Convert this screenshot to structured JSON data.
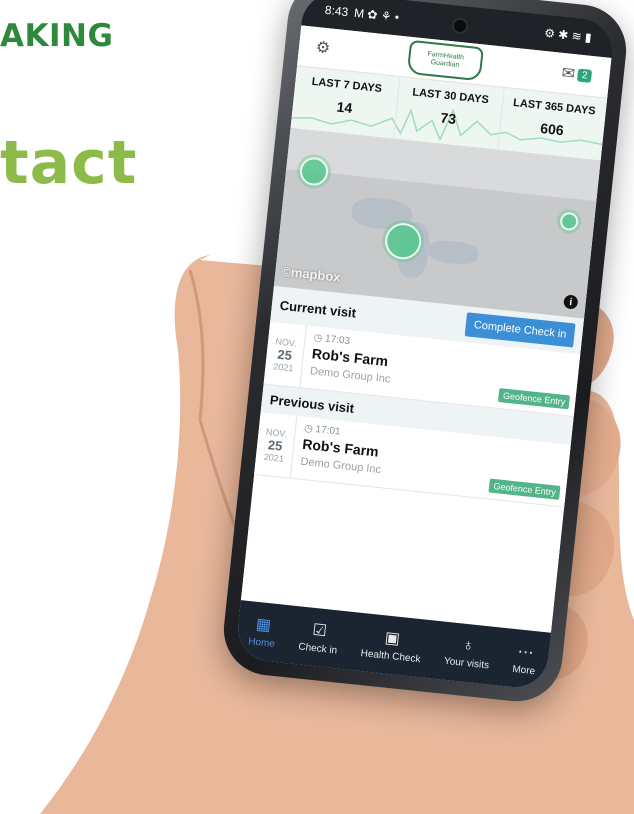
{
  "background": {
    "heading_1": "AKING",
    "heading_2": "tact"
  },
  "status": {
    "time": "8:43",
    "icons_left": "M ✿ ⚘ •",
    "icons_right": "⚙ ✱ ≋ ▮"
  },
  "app": {
    "logo_line1": "FarmHealth",
    "logo_line2": "Guardian",
    "messages_badge": "2",
    "stats": [
      {
        "label": "LAST 7 DAYS",
        "value": "14"
      },
      {
        "label": "LAST 30 DAYS",
        "value": "73"
      },
      {
        "label": "LAST 365 DAYS",
        "value": "606"
      }
    ],
    "map_attribution": "©mapbox",
    "current_section_title": "Current visit",
    "checkin_button": "Complete Check in",
    "current_visit": {
      "month": "NOV.",
      "day": "25",
      "year": "2021",
      "time": "17:03",
      "farm": "Rob's Farm",
      "org": "Demo Group Inc",
      "tag": "Geofence Entry"
    },
    "previous_section_title": "Previous visit",
    "previous_visit": {
      "month": "NOV.",
      "day": "25",
      "year": "2021",
      "time": "17:01",
      "farm": "Rob's Farm",
      "org": "Demo Group Inc",
      "tag": "Geofence Entry"
    },
    "tabs": [
      {
        "label": "Home",
        "icon": "home-grid-icon",
        "active": true
      },
      {
        "label": "Check in",
        "icon": "clipboard-icon",
        "active": false
      },
      {
        "label": "Health Check",
        "icon": "briefcase-icon",
        "active": false
      },
      {
        "label": "Your visits",
        "icon": "visits-icon",
        "active": false
      },
      {
        "label": "More",
        "icon": "more-icon",
        "active": false
      }
    ]
  },
  "colors": {
    "accent_green": "#2ea57a",
    "accent_blue": "#3b8fd6",
    "tab_bg": "#1b2431"
  }
}
